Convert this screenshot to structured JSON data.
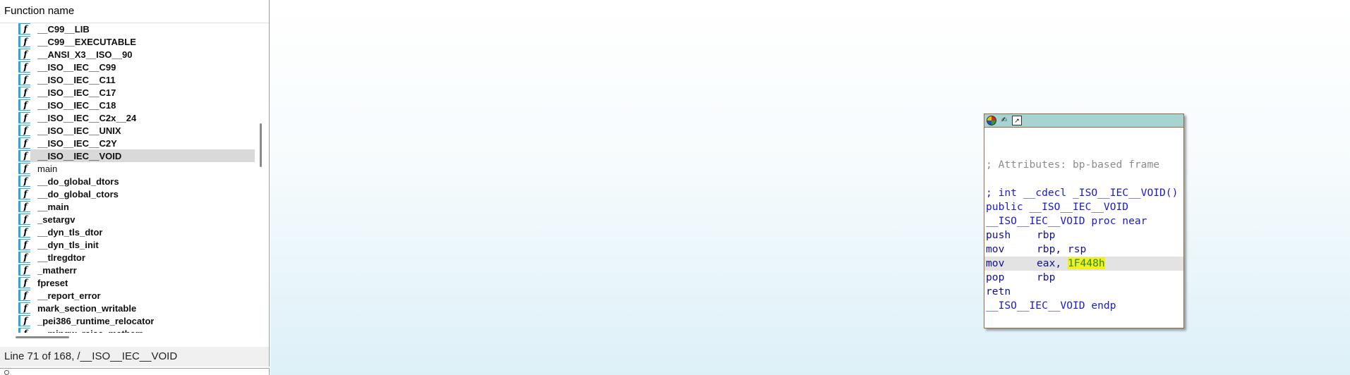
{
  "functions_panel": {
    "header": "Function name",
    "icon_glyph": "f",
    "items": [
      {
        "name": "__C99__LIB",
        "bold": true
      },
      {
        "name": "__C99__EXECUTABLE",
        "bold": true
      },
      {
        "name": "__ANSI_X3__ISO__90",
        "bold": true
      },
      {
        "name": "__ISO__IEC__C99",
        "bold": true
      },
      {
        "name": "__ISO__IEC__C11",
        "bold": true
      },
      {
        "name": "__ISO__IEC__C17",
        "bold": true
      },
      {
        "name": "__ISO__IEC__C18",
        "bold": true
      },
      {
        "name": "__ISO__IEC__C2x__24",
        "bold": true
      },
      {
        "name": "__ISO__IEC__UNIX",
        "bold": true
      },
      {
        "name": "__ISO__IEC__C2Y",
        "bold": true
      },
      {
        "name": "__ISO__IEC__VOID",
        "bold": true,
        "selected": true
      },
      {
        "name": "main",
        "bold": false
      },
      {
        "name": "__do_global_dtors",
        "bold": true
      },
      {
        "name": "__do_global_ctors",
        "bold": true
      },
      {
        "name": "__main",
        "bold": true
      },
      {
        "name": "_setargv",
        "bold": true
      },
      {
        "name": "__dyn_tls_dtor",
        "bold": true
      },
      {
        "name": "__dyn_tls_init",
        "bold": true
      },
      {
        "name": "__tlregdtor",
        "bold": true
      },
      {
        "name": "_matherr",
        "bold": true
      },
      {
        "name": "fpreset",
        "bold": true
      },
      {
        "name": "__report_error",
        "bold": true
      },
      {
        "name": "mark_section_writable",
        "bold": true
      },
      {
        "name": "_pei386_runtime_relocator",
        "bold": true
      },
      {
        "name": "__mingw_raise_matherr",
        "bold": true
      }
    ]
  },
  "status_bar": {
    "text": "Line 71 of 168, /__ISO__IEC__VOID"
  },
  "graph_node": {
    "titlebar_icons": [
      "color-picker-icon",
      "rename-icon",
      "graph-overview-icon"
    ],
    "lines": [
      {
        "kind": "blank",
        "text": ""
      },
      {
        "kind": "blank",
        "text": ""
      },
      {
        "kind": "comment",
        "text": "; Attributes: bp-based frame"
      },
      {
        "kind": "blank",
        "text": ""
      },
      {
        "kind": "decl",
        "text": "; int __cdecl _ISO__IEC__VOID()"
      },
      {
        "kind": "decl",
        "text": "public __ISO__IEC__VOID"
      },
      {
        "kind": "decl",
        "text": "__ISO__IEC__VOID proc near"
      },
      {
        "kind": "ins",
        "mnemonic": "push",
        "operands": "rbp"
      },
      {
        "kind": "ins",
        "mnemonic": "mov",
        "operands": "rbp, rsp"
      },
      {
        "kind": "ins",
        "mnemonic": "mov",
        "operands": "eax, ",
        "immediate": "1F448h",
        "highlight": true
      },
      {
        "kind": "ins",
        "mnemonic": "pop",
        "operands": "rbp"
      },
      {
        "kind": "ins",
        "mnemonic": "retn",
        "operands": ""
      },
      {
        "kind": "decl",
        "text": "__ISO__IEC__VOID endp"
      }
    ]
  },
  "colors": {
    "list_icon_accent": "#2aa7e0",
    "selected_row": "#d9d9d9",
    "node_titlebar": "#a7d3d1",
    "node_border": "#9a6b45",
    "code_blue": "#1a1ad0",
    "comment_gray": "#8c8c8c",
    "immediate_highlight": "#f0f01e",
    "immediate_text": "#2b8a2b"
  }
}
